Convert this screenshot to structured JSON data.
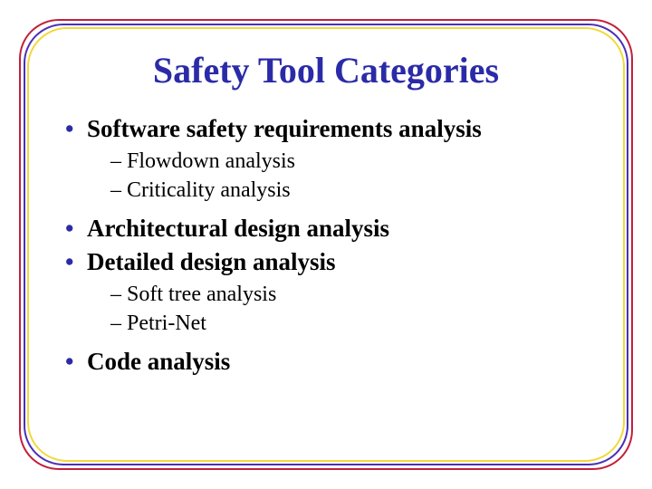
{
  "title": "Safety Tool Categories",
  "items": [
    {
      "label": "Software safety requirements analysis",
      "sub": [
        "Flowdown analysis",
        "Criticality analysis"
      ]
    },
    {
      "label": "Architectural design analysis",
      "sub": []
    },
    {
      "label": "Detailed design analysis",
      "sub": [
        "Soft tree analysis",
        "Petri-Net"
      ]
    },
    {
      "label": "Code analysis",
      "sub": []
    }
  ]
}
